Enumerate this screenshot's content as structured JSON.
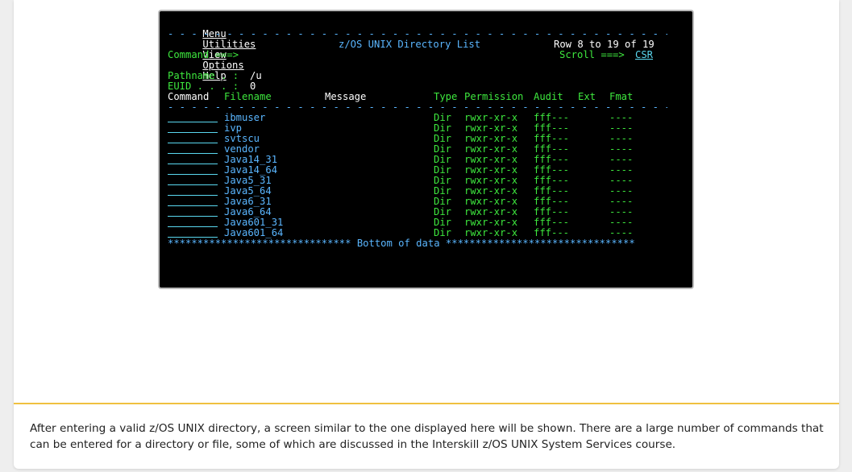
{
  "terminal": {
    "menu": [
      "Menu",
      "Utilities",
      "View",
      "Options",
      "Help"
    ],
    "title": "z/OS UNIX Directory List",
    "row_info": "Row 8 to 19 of 19",
    "command_prompt": "Command ===>",
    "scroll_label": "Scroll ===>",
    "scroll_value": "CSR",
    "pathname_label": "Pathname . :",
    "pathname_value": "/u",
    "euid_label": "EUID . . . :",
    "euid_value": "0",
    "headers": {
      "command": "Command",
      "filename": "Filename",
      "message": "Message",
      "type": "Type",
      "permission": "Permission",
      "audit": "Audit",
      "ext": "Ext",
      "fmat": "Fmat"
    },
    "rows": [
      {
        "filename": "ibmuser",
        "type": "Dir",
        "permission": "rwxr-xr-x",
        "audit": "fff---",
        "fmat": "----"
      },
      {
        "filename": "ivp",
        "type": "Dir",
        "permission": "rwxr-xr-x",
        "audit": "fff---",
        "fmat": "----"
      },
      {
        "filename": "svtscu",
        "type": "Dir",
        "permission": "rwxr-xr-x",
        "audit": "fff---",
        "fmat": "----"
      },
      {
        "filename": "vendor",
        "type": "Dir",
        "permission": "rwxr-xr-x",
        "audit": "fff---",
        "fmat": "----"
      },
      {
        "filename": "Java14_31",
        "type": "Dir",
        "permission": "rwxr-xr-x",
        "audit": "fff---",
        "fmat": "----"
      },
      {
        "filename": "Java14_64",
        "type": "Dir",
        "permission": "rwxr-xr-x",
        "audit": "fff---",
        "fmat": "----"
      },
      {
        "filename": "Java5_31",
        "type": "Dir",
        "permission": "rwxr-xr-x",
        "audit": "fff---",
        "fmat": "----"
      },
      {
        "filename": "Java5_64",
        "type": "Dir",
        "permission": "rwxr-xr-x",
        "audit": "fff---",
        "fmat": "----"
      },
      {
        "filename": "Java6_31",
        "type": "Dir",
        "permission": "rwxr-xr-x",
        "audit": "fff---",
        "fmat": "----"
      },
      {
        "filename": "Java6_64",
        "type": "Dir",
        "permission": "rwxr-xr-x",
        "audit": "fff---",
        "fmat": "----"
      },
      {
        "filename": "Java601_31",
        "type": "Dir",
        "permission": "rwxr-xr-x",
        "audit": "fff---",
        "fmat": "----"
      },
      {
        "filename": "Java601_64",
        "type": "Dir",
        "permission": "rwxr-xr-x",
        "audit": "fff---",
        "fmat": "----"
      }
    ],
    "bottom_stars_left": "*******************************",
    "bottom_label": "Bottom of data",
    "bottom_stars_right": "********************************"
  },
  "caption": "After entering a valid z/OS UNIX directory, a screen similar to the one displayed here will be shown. There are a large number of commands that can be entered for a directory or file, some of which are discussed in the Interskill z/OS UNIX System Services course.",
  "colors": {
    "terminal_bg": "#000000",
    "green": "#3ee83e",
    "blue": "#5ab6ff",
    "turquoise": "#5ad8f0",
    "white": "#ffffff",
    "accent_divider": "#f0c040"
  }
}
